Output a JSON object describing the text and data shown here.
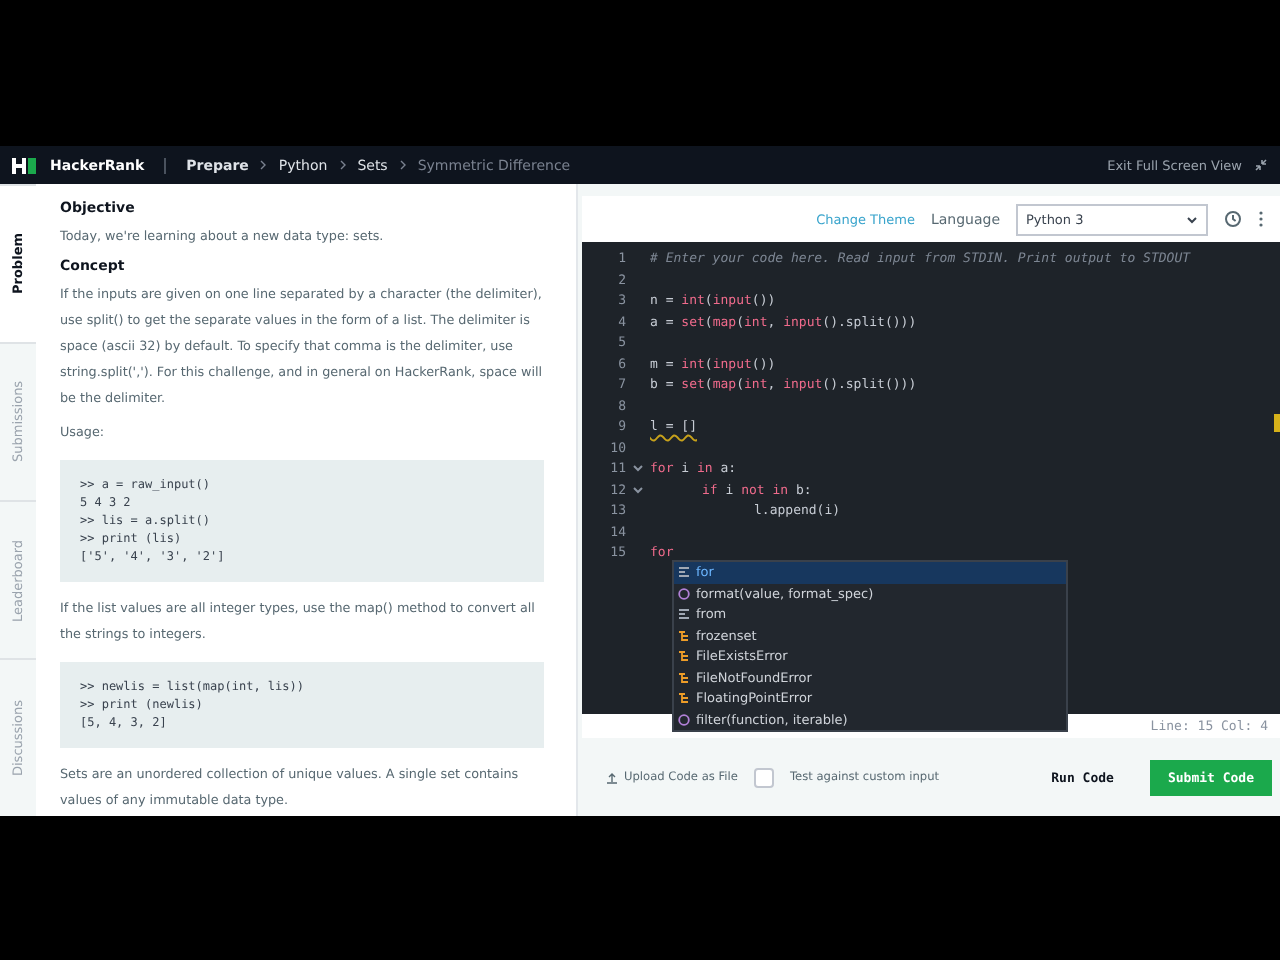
{
  "navbar": {
    "brand": "HackerRank",
    "breadcrumbs": [
      {
        "label": "Prepare",
        "current": false
      },
      {
        "label": "Python",
        "current": false
      },
      {
        "label": "Sets",
        "current": false
      },
      {
        "label": "Symmetric Difference",
        "current": true
      }
    ],
    "exit": "Exit Full Screen View"
  },
  "side_tabs": [
    {
      "label": "Problem",
      "selected": true
    },
    {
      "label": "Submissions",
      "selected": false
    },
    {
      "label": "Leaderboard",
      "selected": false
    },
    {
      "label": "Discussions",
      "selected": false
    }
  ],
  "problem": [
    {
      "kind": "heading",
      "text": "Objective"
    },
    {
      "kind": "para",
      "text": "Today, we're learning about a new data type: sets."
    },
    {
      "kind": "heading",
      "text": "Concept"
    },
    {
      "kind": "para",
      "text": "If the inputs are given on one line separated by a character (the delimiter), use split() to get the separate values in the form of a list. The delimiter is space (ascii 32) by default. To specify that comma is the delimiter, use string.split(','). For this challenge, and in general on HackerRank, space will be the delimiter."
    },
    {
      "kind": "para",
      "text": "Usage:"
    },
    {
      "kind": "code",
      "lines": [
        ">> a = raw_input()",
        "5 4 3 2",
        ">> lis = a.split()",
        ">> print (lis)",
        "['5', '4', '3', '2']"
      ]
    },
    {
      "kind": "para",
      "text": "If the list values are all integer types, use the map() method to convert all the strings to integers."
    },
    {
      "kind": "code",
      "lines": [
        ">> newlis = list(map(int, lis))",
        ">> print (newlis)",
        "[5, 4, 3, 2]"
      ]
    },
    {
      "kind": "para",
      "text": "Sets are an unordered collection of unique values. A single set contains values of any immutable data type."
    }
  ],
  "editor": {
    "change_theme": "Change Theme",
    "language_label": "Language",
    "language": "Python 3",
    "lines": [
      {
        "num": "1",
        "fold": false,
        "tokens": [
          {
            "kind": "comment",
            "text": "# Enter your code here. Read input from STDIN. Print output to STDOUT"
          }
        ]
      },
      {
        "num": "2",
        "fold": false
      },
      {
        "num": "3",
        "fold": false,
        "tokens": [
          {
            "kind": "plain",
            "text": "n = "
          },
          {
            "kind": "builtin",
            "text": "int"
          },
          {
            "kind": "plain",
            "text": "("
          },
          {
            "kind": "builtin",
            "text": "input"
          },
          {
            "kind": "plain",
            "text": "())"
          }
        ]
      },
      {
        "num": "4",
        "fold": false,
        "tokens": [
          {
            "kind": "plain",
            "text": "a = "
          },
          {
            "kind": "builtin",
            "text": "set"
          },
          {
            "kind": "plain",
            "text": "("
          },
          {
            "kind": "builtin",
            "text": "map"
          },
          {
            "kind": "plain",
            "text": "("
          },
          {
            "kind": "builtin",
            "text": "int"
          },
          {
            "kind": "plain",
            "text": ", "
          },
          {
            "kind": "builtin",
            "text": "input"
          },
          {
            "kind": "plain",
            "text": "().split()))"
          }
        ]
      },
      {
        "num": "5",
        "fold": false
      },
      {
        "num": "6",
        "fold": false,
        "tokens": [
          {
            "kind": "plain",
            "text": "m = "
          },
          {
            "kind": "builtin",
            "text": "int"
          },
          {
            "kind": "plain",
            "text": "("
          },
          {
            "kind": "builtin",
            "text": "input"
          },
          {
            "kind": "plain",
            "text": "())"
          }
        ]
      },
      {
        "num": "7",
        "fold": false,
        "tokens": [
          {
            "kind": "plain",
            "text": "b = "
          },
          {
            "kind": "builtin",
            "text": "set"
          },
          {
            "kind": "plain",
            "text": "("
          },
          {
            "kind": "builtin",
            "text": "map"
          },
          {
            "kind": "plain",
            "text": "("
          },
          {
            "kind": "builtin",
            "text": "int"
          },
          {
            "kind": "plain",
            "text": ", "
          },
          {
            "kind": "builtin",
            "text": "input"
          },
          {
            "kind": "plain",
            "text": "().split()))"
          }
        ]
      },
      {
        "num": "8",
        "fold": false
      },
      {
        "num": "9",
        "fold": false,
        "tokens": [
          {
            "kind": "warn",
            "text": "l = []"
          }
        ]
      },
      {
        "num": "10",
        "fold": false
      },
      {
        "num": "11",
        "fold": true,
        "tokens": [
          {
            "kind": "keyword",
            "text": "for"
          },
          {
            "kind": "plain",
            "text": " i "
          },
          {
            "kind": "keyword",
            "text": "in"
          },
          {
            "kind": "plain",
            "text": " a:"
          }
        ],
        "children": [
          {
            "num": "12",
            "fold": true,
            "tokens": [
              {
                "kind": "keyword",
                "text": "if"
              },
              {
                "kind": "plain",
                "text": " i "
              },
              {
                "kind": "keyword",
                "text": "not in"
              },
              {
                "kind": "plain",
                "text": " b:"
              }
            ],
            "children": [
              {
                "num": "13",
                "fold": false,
                "tokens": [
                  {
                    "kind": "plain",
                    "text": "l.append(i)"
                  }
                ]
              }
            ]
          }
        ]
      },
      {
        "num": "14",
        "fold": false
      },
      {
        "num": "15",
        "fold": false,
        "tokens": [
          {
            "kind": "keyword",
            "text": "for"
          }
        ]
      }
    ],
    "suggestions": [
      {
        "kind": "keyword",
        "label": "for",
        "selected": true
      },
      {
        "kind": "function",
        "label": "format(value, format_spec)",
        "selected": false
      },
      {
        "kind": "keyword",
        "label": "from",
        "selected": false
      },
      {
        "kind": "class",
        "label": "frozenset",
        "selected": false
      },
      {
        "kind": "class",
        "label": "FileExistsError",
        "selected": false
      },
      {
        "kind": "class",
        "label": "FileNotFoundError",
        "selected": false
      },
      {
        "kind": "class",
        "label": "FloatingPointError",
        "selected": false
      },
      {
        "kind": "function",
        "label": "filter(function, iterable)",
        "selected": false
      }
    ],
    "status": "Line: 15 Col: 4"
  },
  "footer": {
    "upload": "Upload Code as File",
    "custom_input": {
      "label": "Test against custom input",
      "checked": false
    },
    "run": "Run Code",
    "submit": "Submit Code"
  }
}
